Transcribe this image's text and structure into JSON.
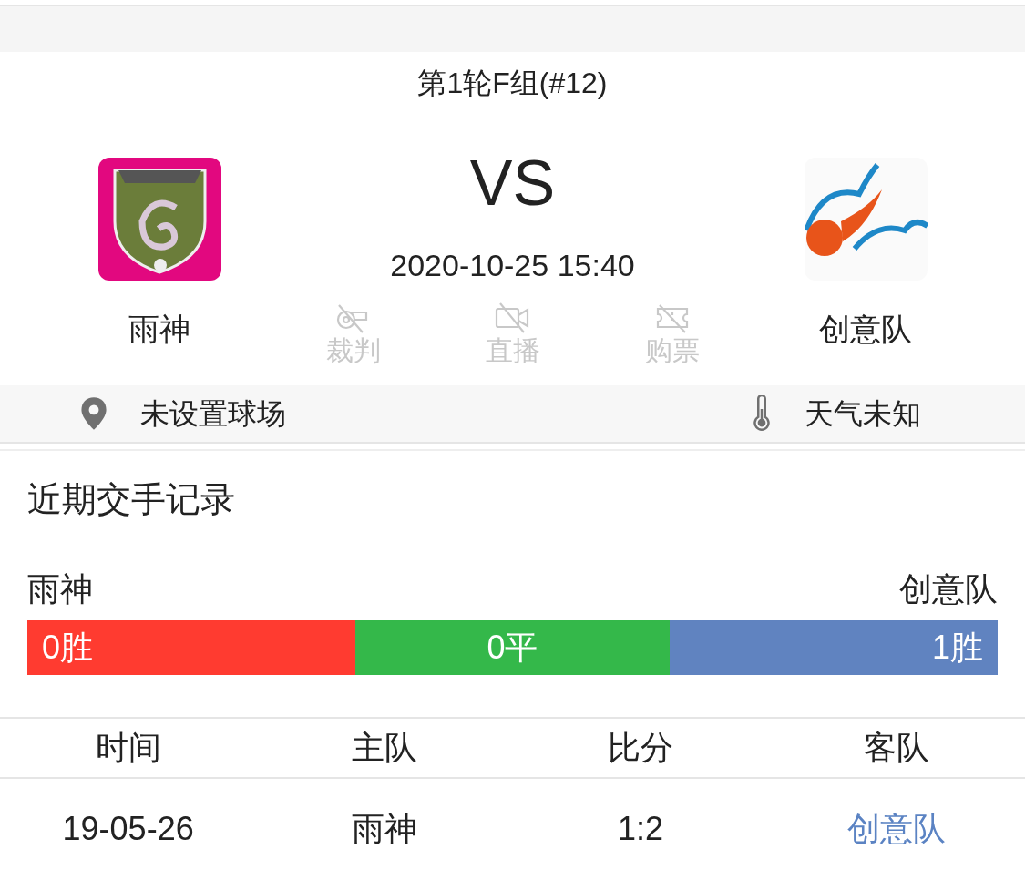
{
  "match": {
    "round": "第1轮F组(#12)",
    "vs": "VS",
    "datetime": "2020-10-25 15:40",
    "home": {
      "name": "雨神"
    },
    "away": {
      "name": "创意队"
    },
    "services": [
      {
        "kind": "referee",
        "label": "裁判",
        "disabled": true
      },
      {
        "kind": "live",
        "label": "直播",
        "disabled": true
      },
      {
        "kind": "ticket",
        "label": "购票",
        "disabled": true
      }
    ]
  },
  "info_bar": {
    "venue": "未设置球场",
    "weather": "天气未知"
  },
  "history": {
    "title": "近期交手记录",
    "home": "雨神",
    "away": "创意队",
    "segments": [
      {
        "label": "0胜",
        "color": "#ff3b30",
        "kind": "home_win"
      },
      {
        "label": "0平",
        "color": "#34b84a",
        "kind": "draw"
      },
      {
        "label": "1胜",
        "color": "#6083c0",
        "kind": "away_win"
      }
    ],
    "table": {
      "columns": [
        "时间",
        "主队",
        "比分",
        "客队"
      ],
      "rows": [
        {
          "cells": [
            "19-05-26",
            "雨神",
            "1:2",
            "创意队"
          ],
          "away_won": true
        }
      ]
    }
  }
}
